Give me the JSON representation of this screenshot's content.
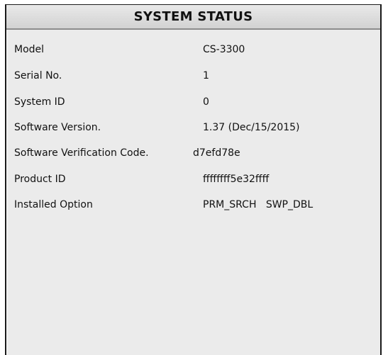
{
  "window": {
    "title": "SYSTEM STATUS"
  },
  "status": {
    "rows": [
      {
        "label": "Model",
        "value": "CS-3300"
      },
      {
        "label": "Serial No.",
        "value": "1"
      },
      {
        "label": "System ID",
        "value": "0"
      },
      {
        "label": "Software Version.",
        "value": "1.37 (Dec/15/2015)"
      },
      {
        "label": "Software Verification Code.",
        "value": "d7efd78e"
      },
      {
        "label": "Product ID",
        "value": "ffffffff5e32ffff"
      },
      {
        "label": "Installed Option",
        "value": "PRM_SRCH   SWP_DBL"
      }
    ]
  }
}
